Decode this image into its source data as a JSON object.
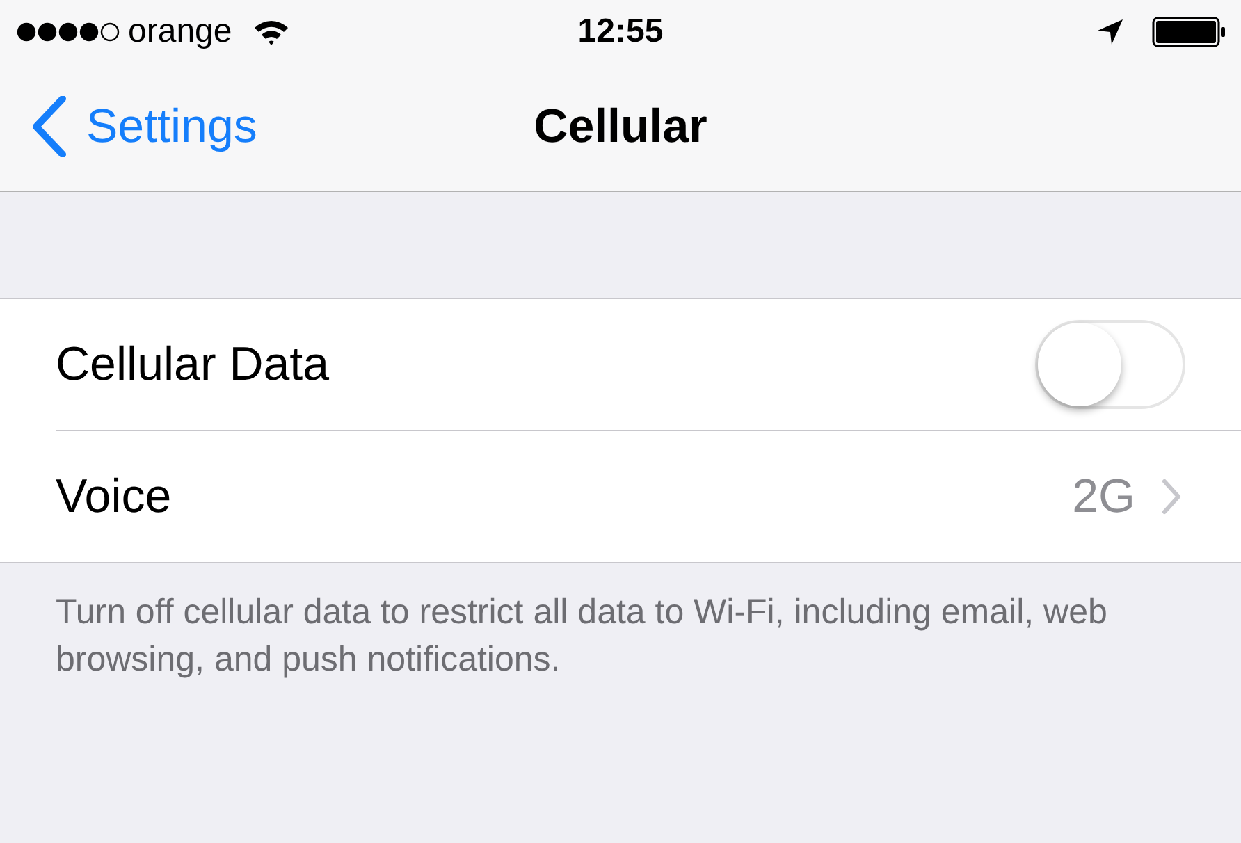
{
  "status_bar": {
    "carrier": "orange",
    "time": "12:55"
  },
  "nav": {
    "back": "Settings",
    "title": "Cellular"
  },
  "rows": [
    {
      "kind": "toggle",
      "label": "Cellular Data",
      "on": false
    },
    {
      "kind": "detail",
      "label": "Voice",
      "value": "2G"
    }
  ],
  "footer": "Turn off cellular data to restrict all data to Wi-Fi, including email, web browsing, and push notifications."
}
